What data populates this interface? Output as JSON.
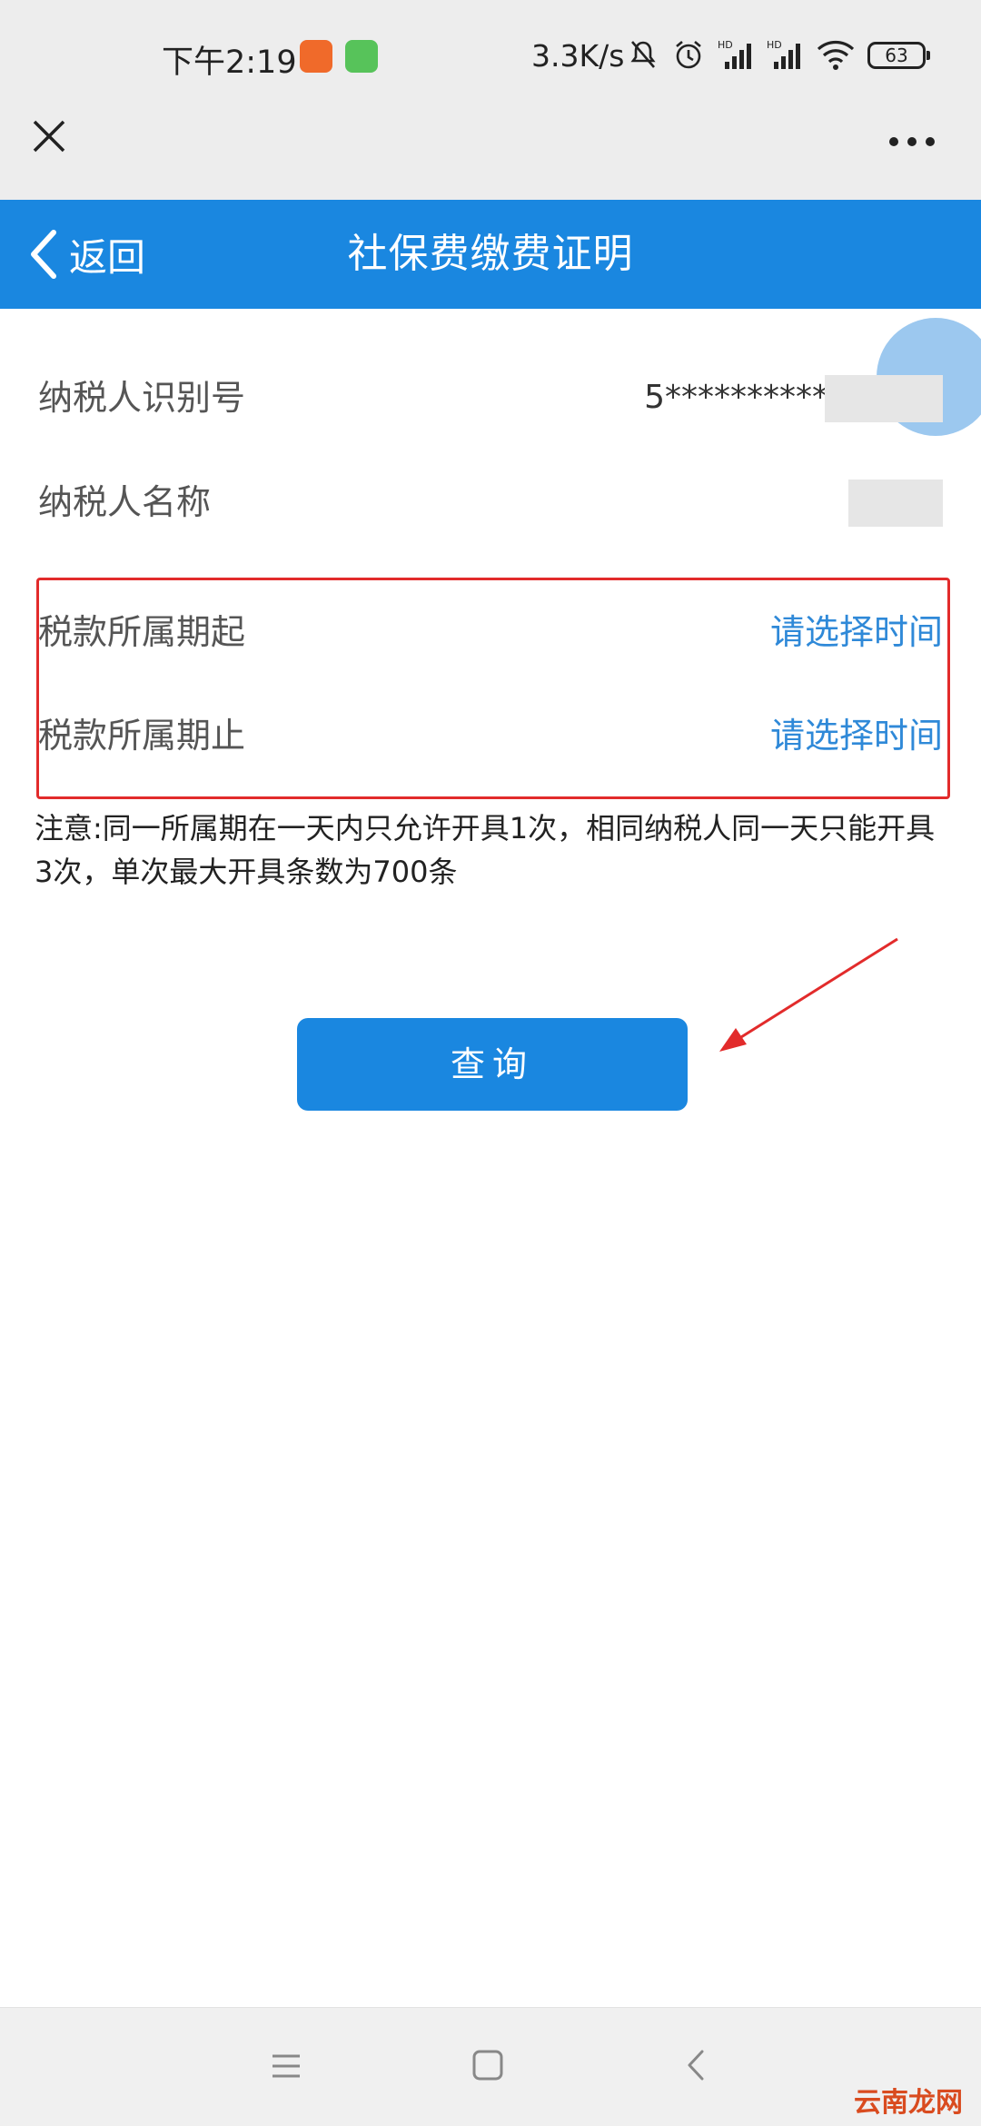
{
  "status_bar": {
    "time": "下午2:19",
    "net_speed": "3.3K/s",
    "battery": "63",
    "icons": [
      "bell-off-icon",
      "alarm-icon",
      "signal-hd-icon",
      "signal-hd-icon",
      "wifi-icon"
    ]
  },
  "wechat_bar": {
    "close_icon": "close-icon",
    "more_icon": "more-icon"
  },
  "header": {
    "back_label": "返回",
    "title": "社保费缴费证明",
    "color": "#1a87e0"
  },
  "form": {
    "taxpayer_id_label": "纳税人识别号",
    "taxpayer_id_value": "5***********",
    "taxpayer_name_label": "纳税人名称",
    "period_start_label": "税款所属期起",
    "period_start_value": "请选择时间",
    "period_end_label": "税款所属期止",
    "period_end_value": "请选择时间"
  },
  "notice": "注意:同一所属期在一天内只允许开具1次，相同纳税人同一天只能开具3次，单次最大开具条数为700条",
  "query_button": "查询",
  "watermark": "云南龙网",
  "colors": {
    "accent": "#1a87e0",
    "link": "#2f89d8",
    "annotation_red": "#e22b2b"
  }
}
